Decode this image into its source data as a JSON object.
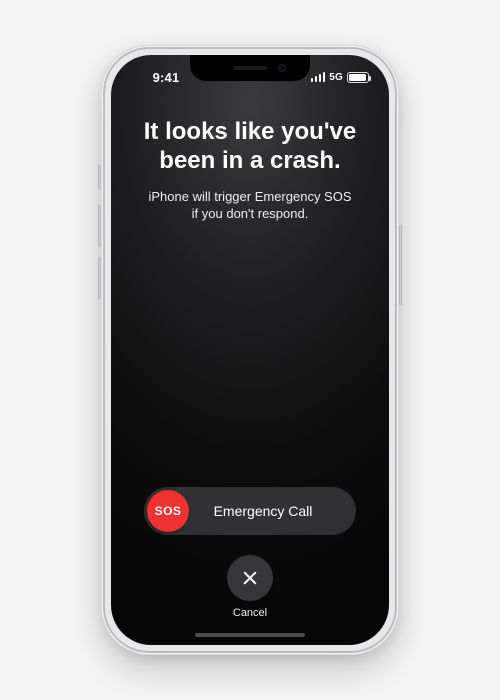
{
  "statusbar": {
    "time": "9:41",
    "network_label": "5G"
  },
  "alert": {
    "heading_line1": "It looks like you've",
    "heading_line2": "been in a crash.",
    "sub_line1": "iPhone will trigger Emergency SOS",
    "sub_line2": "if you don't respond."
  },
  "slider": {
    "knob_label": "SOS",
    "track_label": "Emergency Call"
  },
  "cancel": {
    "label": "Cancel"
  },
  "colors": {
    "sos_red": "#ef3131"
  }
}
